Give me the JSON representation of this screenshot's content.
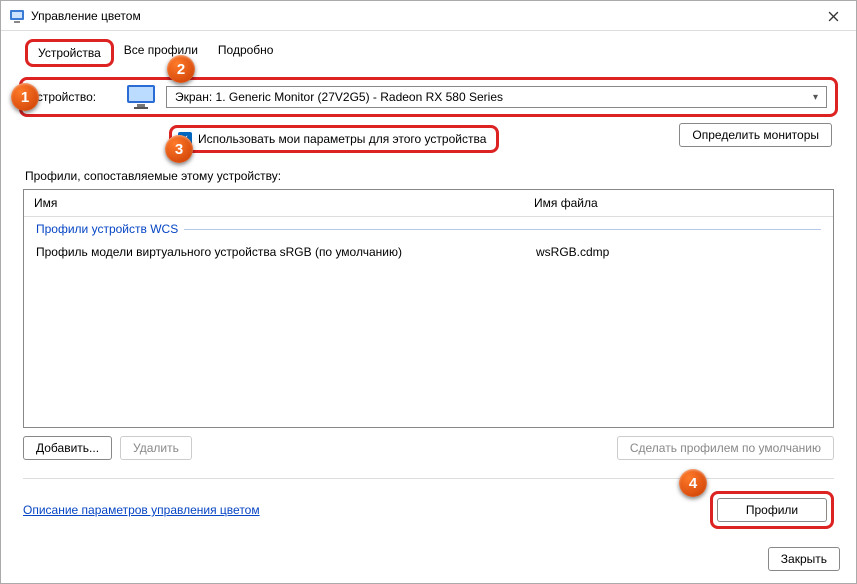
{
  "window": {
    "title": "Управление цветом"
  },
  "tabs": {
    "devices": "Устройства",
    "all_profiles": "Все профили",
    "advanced": "Подробно"
  },
  "device": {
    "label": "Устройство:",
    "selected": "Экран: 1. Generic Monitor (27V2G5) - Radeon RX 580 Series",
    "use_my_settings": "Использовать мои параметры для этого устройства",
    "identify": "Определить мониторы"
  },
  "profiles": {
    "label": "Профили, сопоставляемые этому устройству:",
    "col_name": "Имя",
    "col_file": "Имя файла",
    "group": "Профили устройств WCS",
    "rows": [
      {
        "name": "Профиль модели виртуального устройства sRGB (по умолчанию)",
        "file": "wsRGB.cdmp"
      }
    ]
  },
  "actions": {
    "add": "Добавить...",
    "remove": "Удалить",
    "set_default": "Сделать профилем по умолчанию",
    "help_link": "Описание параметров управления цветом",
    "profiles_btn": "Профили",
    "close": "Закрыть"
  },
  "badges": {
    "b1": "1",
    "b2": "2",
    "b3": "3",
    "b4": "4"
  }
}
